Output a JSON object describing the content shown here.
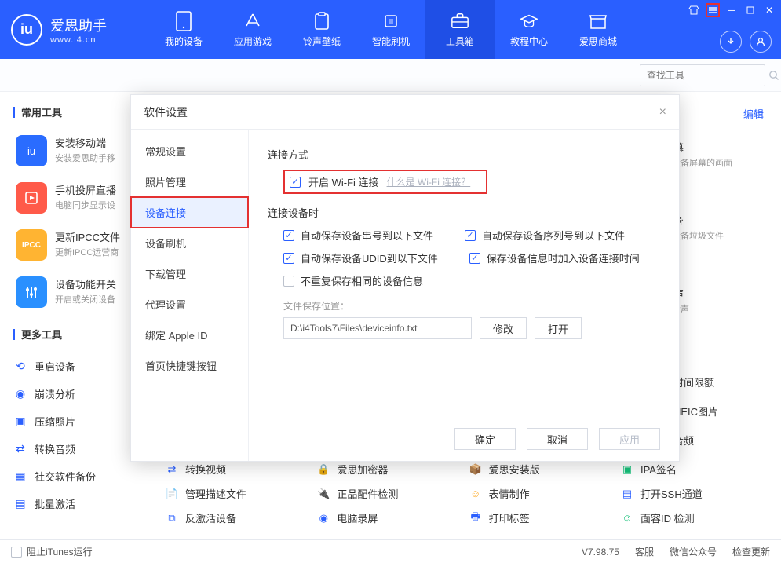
{
  "app": {
    "title": "爱思助手",
    "subtitle": "www.i4.cn"
  },
  "nav": {
    "items": [
      {
        "label": "我的设备"
      },
      {
        "label": "应用游戏"
      },
      {
        "label": "铃声壁纸"
      },
      {
        "label": "智能刷机"
      },
      {
        "label": "工具箱"
      },
      {
        "label": "教程中心"
      },
      {
        "label": "爱思商城"
      }
    ]
  },
  "search": {
    "placeholder": "查找工具"
  },
  "sections": {
    "common": "常用工具",
    "more": "更多工具",
    "edit": "编辑"
  },
  "big_tools": [
    {
      "title": "安装移动端",
      "sub": "安装爱思助手移"
    },
    {
      "title": "手机投屏直播",
      "sub": "电脑同步显示设"
    },
    {
      "title": "更新IPCC文件",
      "sub": "更新IPCC运营商"
    },
    {
      "title": "设备功能开关",
      "sub": "开启或关闭设备"
    }
  ],
  "right_hints": [
    {
      "title": "屏幕",
      "sub": "示设备屏幕的画面"
    },
    {
      "title": "瘦身",
      "sub": "理设备垃圾文件"
    },
    {
      "title": "铃声",
      "sub": "机铃声"
    }
  ],
  "more_tools": {
    "col1": [
      "重启设备",
      "崩溃分析",
      "压缩照片",
      "转换音频",
      "社交软件备份",
      "批量激活"
    ],
    "col2": [
      "转换视频",
      "管理描述文件",
      "反激活设备"
    ],
    "col3": [
      "爱思加密器",
      "正品配件检测",
      "电脑录屏"
    ],
    "col4": [
      "爱思安装版",
      "表情制作",
      "打印标签"
    ],
    "col5": [
      "解时间限额",
      "换HEIC图片",
      "改音频",
      "IPA签名",
      "打开SSH通道",
      "面容ID 检测"
    ]
  },
  "modal": {
    "title": "软件设置",
    "nav": [
      "常规设置",
      "照片管理",
      "设备连接",
      "设备刷机",
      "下载管理",
      "代理设置",
      "绑定 Apple ID",
      "首页快捷键按钮"
    ],
    "section1": "连接方式",
    "wifi_label": "开启 Wi-Fi 连接",
    "wifi_link": "什么是 Wi-Fi 连接？",
    "section2": "连接设备时",
    "opts": {
      "a": "自动保存设备串号到以下文件",
      "b": "自动保存设备序列号到以下文件",
      "c": "自动保存设备UDID到以下文件",
      "d": "保存设备信息时加入设备连接时间",
      "e": "不重复保存相同的设备信息"
    },
    "file_label": "文件保存位置：",
    "file_path": "D:\\i4Tools7\\Files\\deviceinfo.txt",
    "modify": "修改",
    "open": "打开",
    "ok": "确定",
    "cancel": "取消",
    "apply": "应用"
  },
  "status": {
    "itunes": "阻止iTunes运行",
    "version": "V7.98.75",
    "kefu": "客服",
    "wechat": "微信公众号",
    "update": "检查更新"
  }
}
